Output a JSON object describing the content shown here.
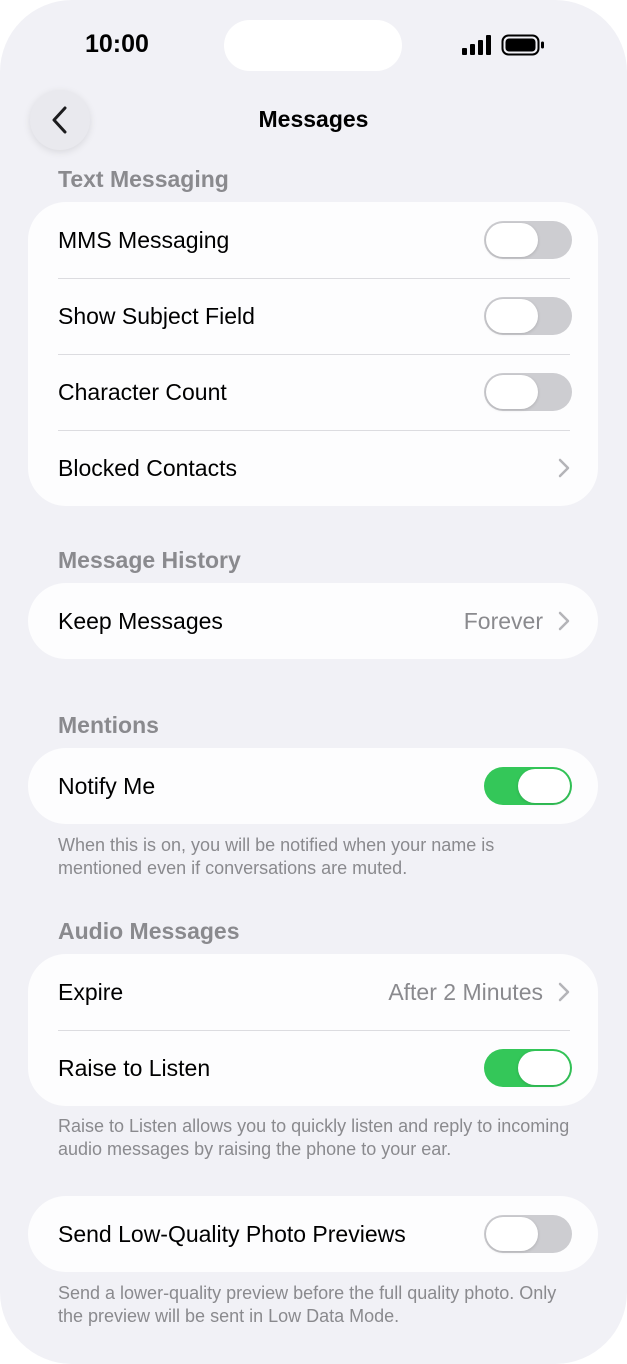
{
  "status_bar": {
    "time": "10:00"
  },
  "nav": {
    "title": "Messages",
    "back_icon": "chevron-left-icon"
  },
  "sections": {
    "text_messaging": {
      "header": "Text Messaging",
      "mms": {
        "label": "MMS Messaging",
        "on": false
      },
      "subject": {
        "label": "Show Subject Field",
        "on": false
      },
      "char_count": {
        "label": "Character Count",
        "on": false
      },
      "blocked": {
        "label": "Blocked Contacts"
      }
    },
    "history": {
      "header": "Message History",
      "keep": {
        "label": "Keep Messages",
        "value": "Forever"
      }
    },
    "mentions": {
      "header": "Mentions",
      "notify": {
        "label": "Notify Me",
        "on": true
      },
      "footnote": "When this is on, you will be notified when your name is mentioned even if conversations are muted."
    },
    "audio": {
      "header": "Audio Messages",
      "expire": {
        "label": "Expire",
        "value": "After 2 Minutes"
      },
      "raise": {
        "label": "Raise to Listen",
        "on": true
      },
      "footnote": "Raise to Listen allows you to quickly listen and reply to incoming audio messages by raising the phone to your ear."
    },
    "photo": {
      "previews": {
        "label": "Send Low-Quality Photo Previews",
        "on": false
      },
      "footnote": "Send a lower-quality preview before the full quality photo. Only the preview will be sent in Low Data Mode."
    }
  },
  "colors": {
    "toggle_on": "#34c759",
    "toggle_off": "#cdcdd1",
    "background": "#f1f1f6",
    "secondary_text": "#8a8a8e"
  }
}
